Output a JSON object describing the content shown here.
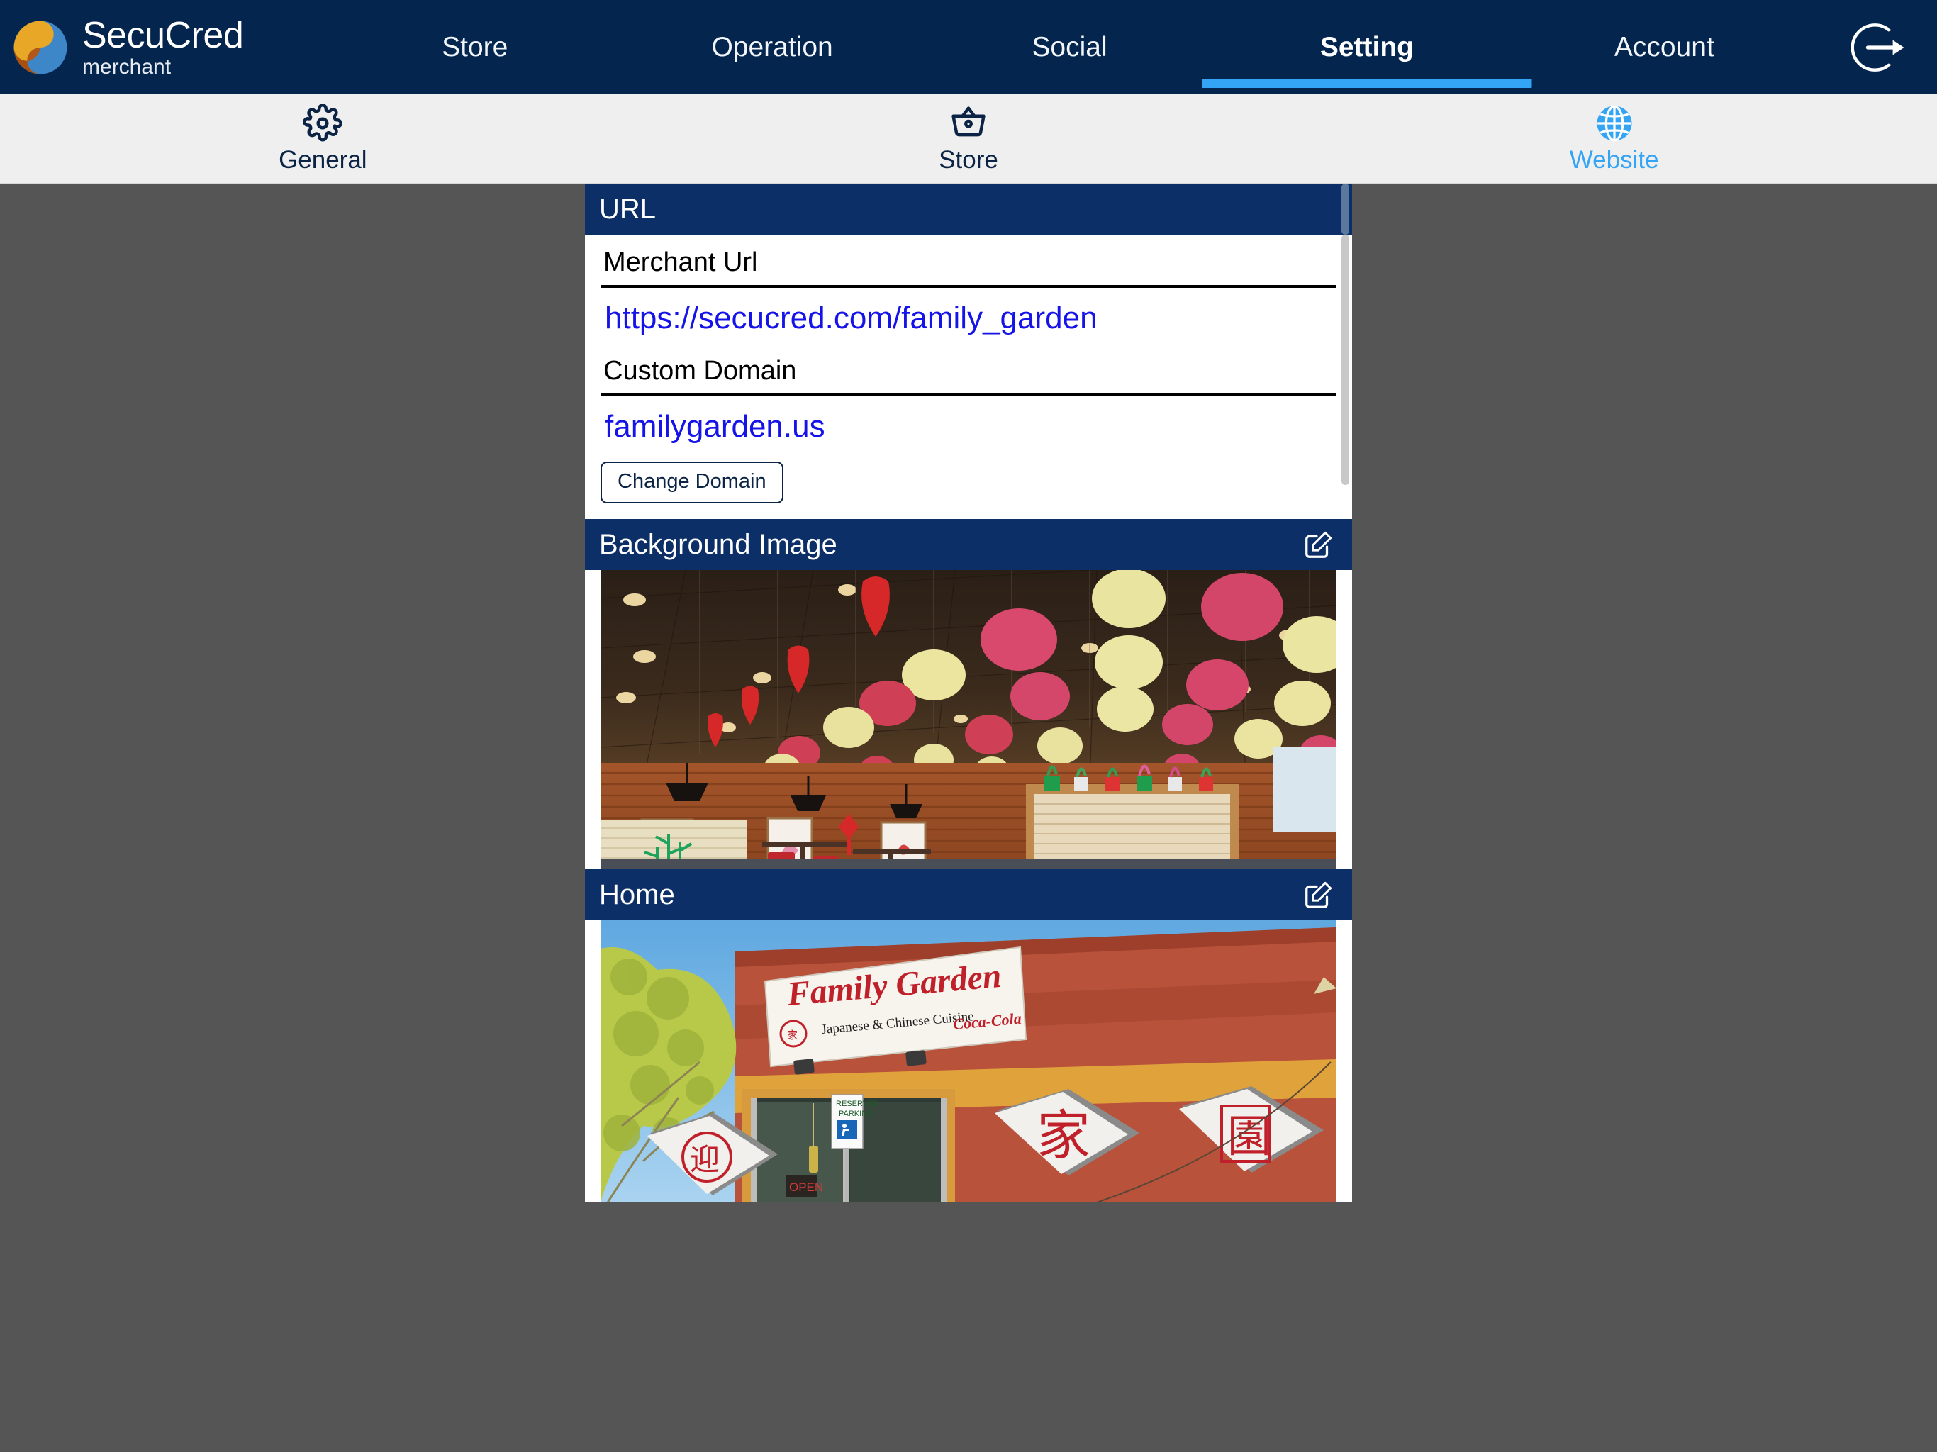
{
  "brand": {
    "name": "SecuCred",
    "subtitle": "merchant",
    "logo_icon": "yin-yang-logo-icon"
  },
  "topnav": {
    "items": [
      {
        "label": "Store",
        "active": false
      },
      {
        "label": "Operation",
        "active": false
      },
      {
        "label": "Social",
        "active": false
      },
      {
        "label": "Setting",
        "active": true
      },
      {
        "label": "Account",
        "active": false
      }
    ],
    "logout_icon": "logout-icon",
    "active_underline_color": "#34a5f4",
    "background_color": "#04254e"
  },
  "subtabs": {
    "items": [
      {
        "label": "General",
        "icon": "gear-icon",
        "active": false
      },
      {
        "label": "Store",
        "icon": "basket-icon",
        "active": false
      },
      {
        "label": "Website",
        "icon": "globe-icon",
        "active": true
      }
    ],
    "active_color": "#34a5f4",
    "inactive_color": "#0b2344",
    "background_color": "#efefef"
  },
  "sections": {
    "url": {
      "header": "URL",
      "merchant_url_label": "Merchant Url",
      "merchant_url_value": "https://secucred.com/family_garden",
      "custom_domain_label": "Custom Domain",
      "custom_domain_value": "familygarden.us",
      "change_domain_button": "Change Domain",
      "link_color": "#1513e8"
    },
    "background_image": {
      "header": "Background Image",
      "edit_icon": "edit-icon",
      "photo_alt": "restaurant-interior-with-red-and-yellow-paper-lanterns"
    },
    "home": {
      "header": "Home",
      "edit_icon": "edit-icon",
      "photo_alt": "family-garden-storefront-exterior",
      "sign_title": "Family Garden",
      "sign_subtitle": "Japanese & Chinese Cuisine",
      "sign_brand": "Coca-Cola",
      "parking_sign_line1": "RESERVED",
      "parking_sign_line2": "PARKING"
    }
  },
  "colors": {
    "card_header": "#0d2f68",
    "page_background": "#555555",
    "card_background": "#ffffff"
  }
}
